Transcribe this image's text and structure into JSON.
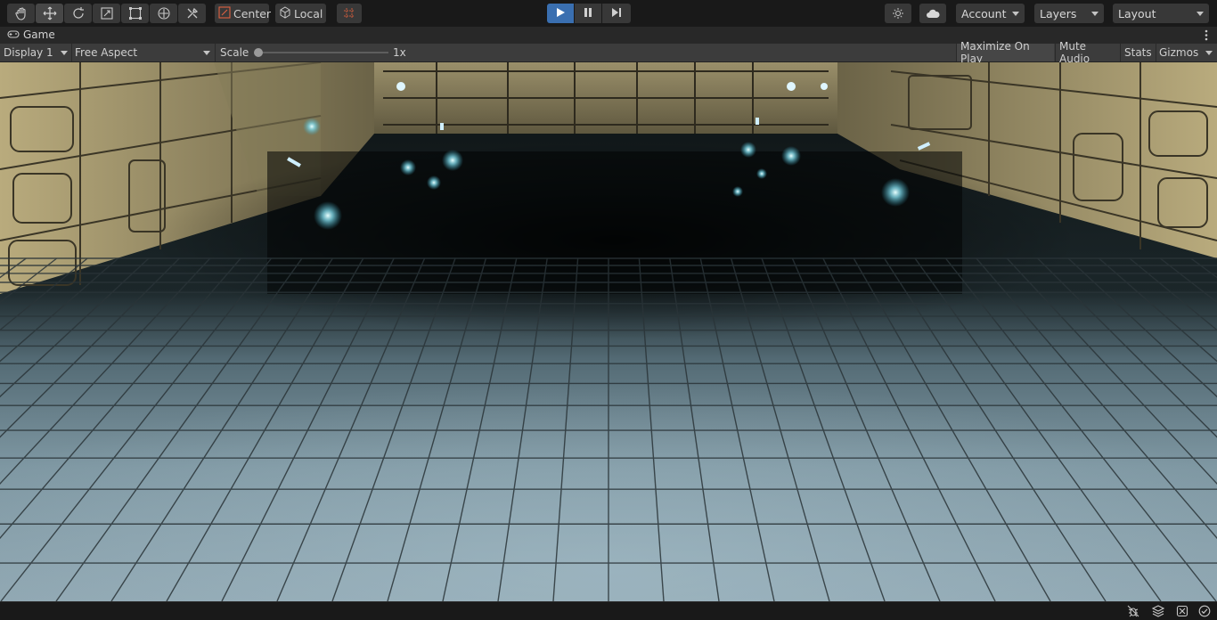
{
  "toolbar": {
    "tools": [
      {
        "name": "hand-tool",
        "icon": "hand-icon"
      },
      {
        "name": "move-tool",
        "icon": "move-icon"
      },
      {
        "name": "rotate-tool",
        "icon": "rotate-icon"
      },
      {
        "name": "scale-tool",
        "icon": "scale-icon"
      },
      {
        "name": "rect-tool",
        "icon": "rect-icon"
      },
      {
        "name": "transform-tool",
        "icon": "transform-icon"
      },
      {
        "name": "custom-tool",
        "icon": "custom-tools-icon"
      }
    ],
    "pivot_label": "Center",
    "space_label": "Local",
    "snap_icon": "grid-snap-icon",
    "playmode": {
      "play_icon": "play-icon",
      "pause_icon": "pause-icon",
      "step_icon": "step-icon",
      "playing": true
    },
    "services_icon": "services-icon",
    "cloud_icon": "cloud-icon",
    "account_label": "Account",
    "layers_label": "Layers",
    "layout_label": "Layout",
    "accent_color": "#3a6fb0"
  },
  "game_tab": {
    "icon": "gamepad-icon",
    "title": "Game",
    "menu_icon": "kebab-menu-icon"
  },
  "game_controls": {
    "display": "Display 1",
    "aspect": "Free Aspect",
    "scale_label": "Scale",
    "scale_value": "1x",
    "scale_level": 0,
    "maximize_on_play": "Maximize On Play",
    "mute_audio": "Mute Audio",
    "stats": "Stats",
    "gizmos": "Gizmos"
  },
  "statusbar": {
    "icons": [
      "bug-icon",
      "layers-stack-icon",
      "no-entry-icon",
      "check-circle-icon"
    ]
  }
}
